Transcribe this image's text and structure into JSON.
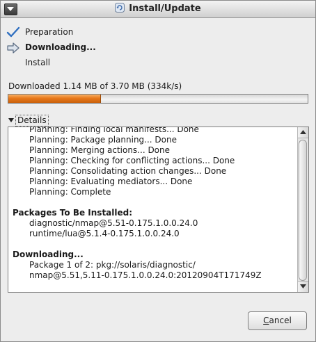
{
  "window": {
    "title": "Install/Update"
  },
  "steps": [
    {
      "label": "Preparation",
      "state": "done"
    },
    {
      "label": "Downloading...",
      "state": "current"
    },
    {
      "label": "Install",
      "state": "pending"
    }
  ],
  "progress": {
    "label": "Downloaded 1.14 MB of 3.70 MB (334k/s)",
    "fraction": 0.31
  },
  "details": {
    "toggle_label": "Details",
    "expanded": true,
    "lines": [
      {
        "text": "Planning: Finding local manifests... Done",
        "style": "indent"
      },
      {
        "text": "Planning: Package planning... Done",
        "style": "indent"
      },
      {
        "text": "Planning: Merging actions... Done",
        "style": "indent"
      },
      {
        "text": "Planning: Checking for conflicting actions... Done",
        "style": "indent"
      },
      {
        "text": "Planning: Consolidating action changes... Done",
        "style": "indent"
      },
      {
        "text": "Planning: Evaluating mediators... Done",
        "style": "indent"
      },
      {
        "text": "Planning: Complete",
        "style": "indent"
      },
      {
        "text": "",
        "style": "blank"
      },
      {
        "text": "Packages To Be Installed:",
        "style": "header"
      },
      {
        "text": "diagnostic/nmap@5.51-0.175.1.0.0.24.0",
        "style": "indent"
      },
      {
        "text": "runtime/lua@5.1.4-0.175.1.0.0.24.0",
        "style": "indent"
      },
      {
        "text": "",
        "style": "blank"
      },
      {
        "text": "Downloading...",
        "style": "header"
      },
      {
        "text": "Package 1 of 2: pkg://solaris/diagnostic/",
        "style": "indent"
      },
      {
        "text": "nmap@5.51,5.11-0.175.1.0.0.24.0:20120904T171749Z",
        "style": "indent"
      }
    ]
  },
  "buttons": {
    "cancel_label": "Cancel",
    "cancel_mnemonic": "C",
    "cancel_rest": "ancel"
  },
  "colors": {
    "progress_fill": "#e8791a",
    "check": "#2f6fc0"
  }
}
